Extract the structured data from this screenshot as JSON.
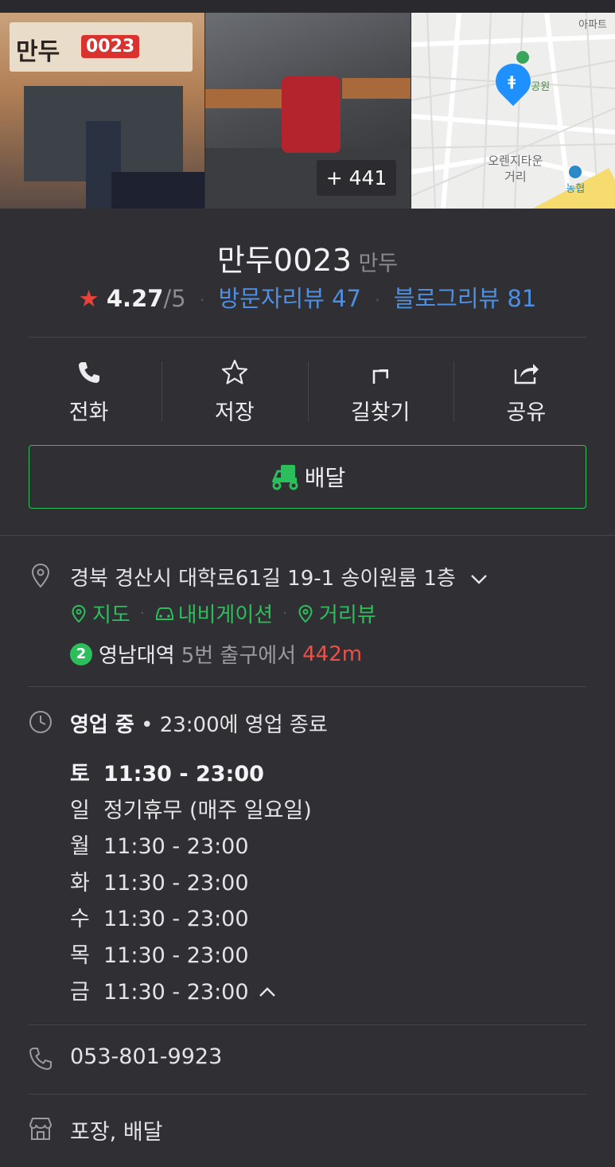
{
  "photos": {
    "storefront_sign": "만두",
    "storefront_badge": "0023",
    "more_count": "+ 441",
    "map": {
      "apt_label": "아파트",
      "park_label": "공원",
      "place_label_line1": "오렌지타운",
      "place_label_line2": "거리",
      "bank_label": "농협"
    }
  },
  "place": {
    "name": "만두0023",
    "category": "만두",
    "rating": "4.27",
    "rating_max": "/5",
    "visitor_reviews": "방문자리뷰 47",
    "blog_reviews": "블로그리뷰 81"
  },
  "actions": [
    {
      "label": "전화",
      "icon": "phone-icon"
    },
    {
      "label": "저장",
      "icon": "star-outline-icon"
    },
    {
      "label": "길찾기",
      "icon": "directions-icon"
    },
    {
      "label": "공유",
      "icon": "share-icon"
    }
  ],
  "delivery": {
    "label": "배달",
    "icon": "delivery-scooter-icon",
    "accent": "#2dbe5c"
  },
  "address": {
    "text": "경북 경산시 대학로61길 19-1 송이원룸 1층",
    "links": [
      "지도",
      "내비게이션",
      "거리뷰"
    ]
  },
  "subway": {
    "line": "2",
    "station": "영남대역",
    "exit": "5번 출구에서",
    "distance": "442m"
  },
  "hours": {
    "status": "영업 중",
    "close_info": "23:00에 영업 종료",
    "days": [
      {
        "day": "토",
        "time": "11:30 - 23:00"
      },
      {
        "day": "일",
        "time": "정기휴무 (매주 일요일)"
      },
      {
        "day": "월",
        "time": "11:30 - 23:00"
      },
      {
        "day": "화",
        "time": "11:30 - 23:00"
      },
      {
        "day": "수",
        "time": "11:30 - 23:00"
      },
      {
        "day": "목",
        "time": "11:30 - 23:00"
      },
      {
        "day": "금",
        "time": "11:30 - 23:00"
      }
    ]
  },
  "phone": "053-801-9923",
  "services": "포장, 배달",
  "colors": {
    "background": "#303034",
    "green": "#2dbe5c",
    "blue": "#4d8fe0",
    "red": "#e8524a"
  }
}
